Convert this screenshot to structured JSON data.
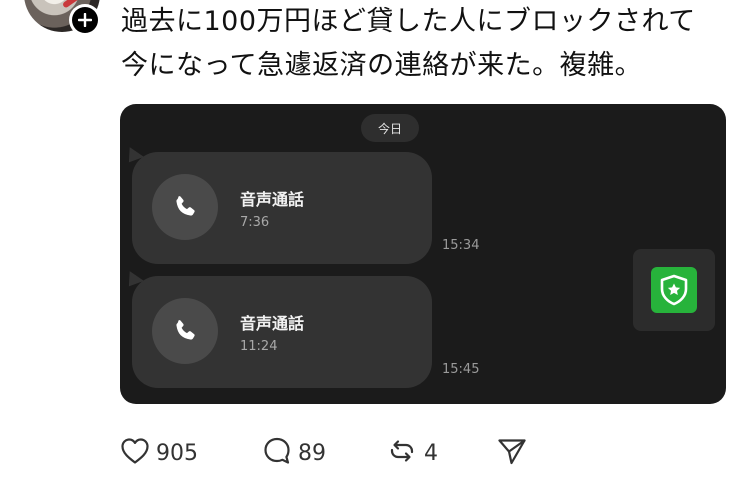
{
  "post": {
    "author_avatar_icon": "user-avatar",
    "follow_icon": "plus-icon",
    "text_line_1": "過去に100万円ほど貸した人にブロックされて",
    "text_line_2": "今になって急遽返済の連絡が来た。複雑。"
  },
  "media": {
    "date_label": "今日",
    "calls": [
      {
        "icon": "phone-icon",
        "title": "音声通話",
        "duration": "7:36",
        "time": "15:34"
      },
      {
        "icon": "phone-icon",
        "title": "音声通話",
        "duration": "11:24",
        "time": "15:45"
      }
    ],
    "badge_icon": "shield-star-icon",
    "badge_color": "#27b33b",
    "background_color": "#1b1b1b"
  },
  "actions": {
    "likes": "905",
    "replies": "89",
    "reposts": "4",
    "like_icon": "heart-icon",
    "reply_icon": "comment-icon",
    "repost_icon": "repost-icon",
    "share_icon": "send-icon"
  }
}
